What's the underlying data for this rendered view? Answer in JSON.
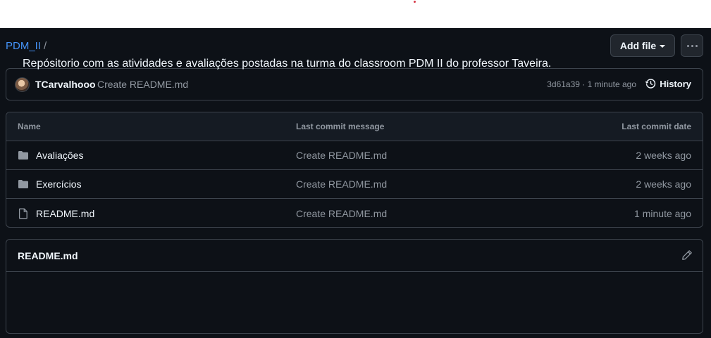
{
  "breadcrumb": {
    "repo": "PDM_II",
    "separator": "/"
  },
  "header_actions": {
    "add_file_label": "Add file",
    "more_icon": "kebab-horizontal-icon"
  },
  "latest_commit": {
    "author": "TCarvalhooo",
    "message": "Create README.md",
    "meta": "3d61a39 · 1 minute ago",
    "history_label": "History"
  },
  "file_table": {
    "headers": {
      "name": "Name",
      "message": "Last commit message",
      "date": "Last commit date"
    },
    "rows": [
      {
        "type": "folder",
        "icon": "folder-icon",
        "name": "Avaliações",
        "message": "Create README.md",
        "date": "2 weeks ago"
      },
      {
        "type": "folder",
        "icon": "folder-icon",
        "name": "Exercícios",
        "message": "Create README.md",
        "date": "2 weeks ago"
      },
      {
        "type": "file",
        "icon": "file-icon",
        "name": "README.md",
        "message": "Create README.md",
        "date": "1 minute ago"
      }
    ]
  },
  "readme": {
    "title": "README.md",
    "content": "Repósitorio com as atividades e avaliações postadas na turma do classroom PDM II do professor Taveira."
  }
}
